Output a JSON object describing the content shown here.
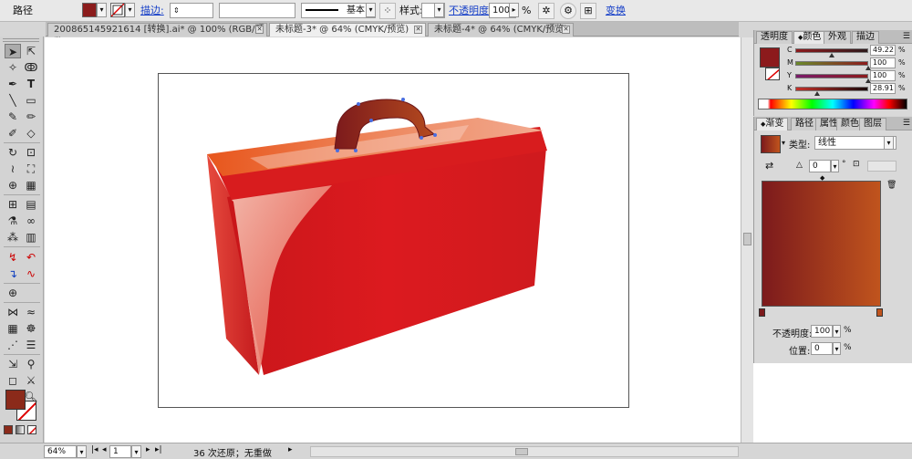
{
  "control_bar": {
    "object_type": "路径",
    "fill_color": "#8b1c1c",
    "stroke_label": "描边:",
    "stroke_profile": "基本",
    "style_label": "样式:",
    "opacity_label": "不透明度:",
    "opacity_value": "100",
    "opacity_unit": "%",
    "transform_label": "变换"
  },
  "tabs": [
    {
      "label": "200865145921614 [转换].ai* @ 100% (RGB/预览)",
      "active": false
    },
    {
      "label": "未标题-3* @ 64% (CMYK/预览)",
      "active": true
    },
    {
      "label": "未标题-4* @ 64% (CMYK/预览)",
      "active": false
    }
  ],
  "color_panel": {
    "tabs": [
      "透明度",
      "颜色",
      "外观",
      "描边"
    ],
    "swatch": "#8c1a1c",
    "channels": [
      {
        "name": "C",
        "value": "49.22",
        "unit": "%"
      },
      {
        "name": "M",
        "value": "100",
        "unit": "%"
      },
      {
        "name": "Y",
        "value": "100",
        "unit": "%"
      },
      {
        "name": "K",
        "value": "28.91",
        "unit": "%"
      }
    ]
  },
  "gradient_panel": {
    "tabs": [
      "渐变",
      "路径",
      "属性",
      "颜色",
      "图层"
    ],
    "type_label": "类型:",
    "type_value": "线性",
    "angle_value": "0",
    "angle_unit": "°",
    "start_color": "#7c1a1c",
    "end_color": "#c0541d",
    "opacity_label": "不透明度:",
    "opacity_value": "100",
    "opacity_unit": "%",
    "position_label": "位置:",
    "position_value": "0",
    "position_unit": "%"
  },
  "tools": {
    "fill": "#8b2a1a",
    "stroke": "none"
  },
  "status_bar": {
    "zoom": "64%",
    "page": "1",
    "message": "36 次还原；无重做"
  }
}
